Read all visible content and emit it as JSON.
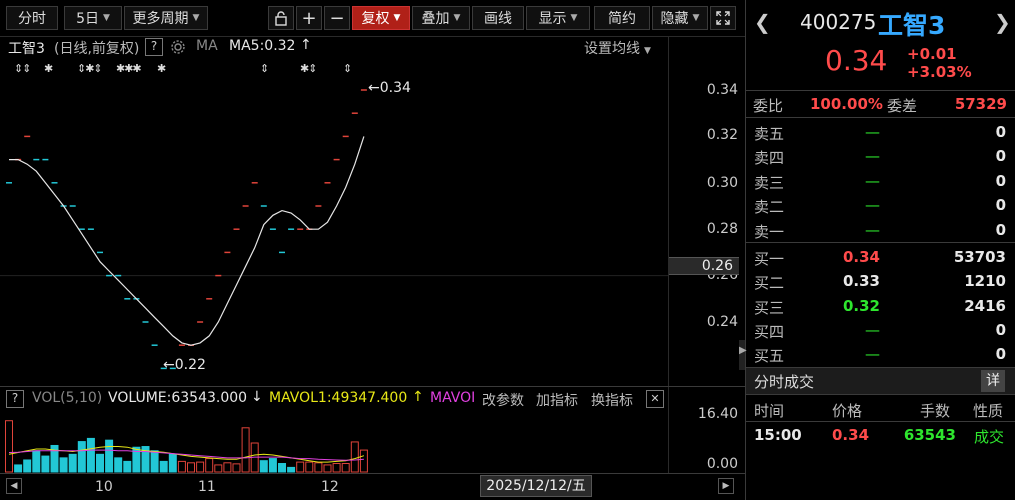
{
  "toolbar": {
    "tab_timeshare": "分时",
    "period_5day": "5日",
    "more_periods": "更多周期",
    "lock_icon": "lock-icon",
    "zoom_in": "+",
    "zoom_out": "−",
    "adjust": "复权",
    "overlay": "叠加",
    "draw": "画线",
    "display": "显示",
    "profile": "简约",
    "hide": "隐藏",
    "fullscreen_icon": "expand-icon"
  },
  "chart_header": {
    "name": "工智3",
    "mode": "(日线,前复权)",
    "help": "?",
    "ma_label": "MA",
    "ma5": "MA5:0.32",
    "ma5_arrow": "↑",
    "settings": "设置均线",
    "high_label": "0.34",
    "low_label": "0.22",
    "high_arrow": "←",
    "low_arrow": "←"
  },
  "volume_header": {
    "help": "?",
    "vol": "VOL(5,10)",
    "volume": "VOLUME:63543.000",
    "volume_arrow": "↓",
    "mavol1": "MAVOL1:49347.400",
    "mavol1_arrow": "↑",
    "mavol2": "MAVOI",
    "edit_params": "改参数",
    "add_indicator": "加指标",
    "switch_indicator": "换指标",
    "close": "✕"
  },
  "price_axis": [
    "0.34",
    "0.32",
    "0.30",
    "0.28",
    "0.26",
    "0.24"
  ],
  "current_price_tag": "0.26",
  "volume_axis": [
    "16.40",
    "0.00"
  ],
  "x_axis": [
    "10",
    "11",
    "12"
  ],
  "date_tag": "2025/12/12/五",
  "quote": {
    "code": "400275",
    "name": "工智3",
    "price": "0.34",
    "change": "+0.01",
    "change_pct": "+3.03%"
  },
  "order_ratio": {
    "ratio_label": "委比",
    "ratio_value": "100.00%",
    "diff_label": "委差",
    "diff_value": "57329"
  },
  "asks": [
    {
      "label": "卖五",
      "price": "—",
      "vol": "0"
    },
    {
      "label": "卖四",
      "price": "—",
      "vol": "0"
    },
    {
      "label": "卖三",
      "price": "—",
      "vol": "0"
    },
    {
      "label": "卖二",
      "price": "—",
      "vol": "0"
    },
    {
      "label": "卖一",
      "price": "—",
      "vol": "0"
    }
  ],
  "bids": [
    {
      "label": "买一",
      "price": "0.34",
      "vol": "53703"
    },
    {
      "label": "买二",
      "price": "0.33",
      "vol": "1210"
    },
    {
      "label": "买三",
      "price": "0.32",
      "vol": "2416"
    },
    {
      "label": "买四",
      "price": "—",
      "vol": "0"
    },
    {
      "label": "买五",
      "price": "—",
      "vol": "0"
    }
  ],
  "trades": {
    "title": "分时成交",
    "detail": "详",
    "headers": [
      "时间",
      "价格",
      "手数",
      "性质"
    ],
    "rows": [
      {
        "time": "15:00",
        "price": "0.34",
        "vol": "63543",
        "nature": "成交"
      }
    ]
  },
  "colors": {
    "up": "#ff4b4b",
    "down": "#2ee62e",
    "kline_up": "#e0443a",
    "kline_down": "#22c7d6",
    "ma": "#e6e6e6",
    "mavol1": "#e8e817",
    "mavol2": "#e040e0",
    "active_button": "#b02018"
  },
  "chart_data": [
    {
      "type": "candlestick",
      "title": "",
      "ylim": [
        0.22,
        0.34
      ],
      "x_axis_ticks": [
        "10",
        "11",
        "12"
      ],
      "y_axis_ticks": [
        "0.34",
        "0.32",
        "0.30",
        "0.28",
        "0.26",
        "0.24"
      ],
      "closes": [
        0.3,
        0.31,
        0.32,
        0.31,
        0.31,
        0.3,
        0.29,
        0.29,
        0.28,
        0.28,
        0.27,
        0.26,
        0.26,
        0.25,
        0.25,
        0.24,
        0.23,
        0.22,
        0.22,
        0.23,
        0.23,
        0.24,
        0.25,
        0.26,
        0.27,
        0.28,
        0.29,
        0.3,
        0.29,
        0.28,
        0.27,
        0.28,
        0.28,
        0.28,
        0.29,
        0.3,
        0.31,
        0.32,
        0.33,
        0.34
      ],
      "direction": [
        "d",
        "u",
        "u",
        "d",
        "d",
        "d",
        "d",
        "d",
        "d",
        "d",
        "d",
        "d",
        "d",
        "d",
        "d",
        "d",
        "d",
        "d",
        "d",
        "u",
        "u",
        "u",
        "u",
        "u",
        "u",
        "u",
        "u",
        "u",
        "d",
        "d",
        "d",
        "d",
        "u",
        "u",
        "u",
        "u",
        "u",
        "u",
        "u",
        "u"
      ],
      "ma5": [
        0.31,
        0.31,
        0.308,
        0.305,
        0.3,
        0.295,
        0.29,
        0.284,
        0.278,
        0.272,
        0.266,
        0.262,
        0.258,
        0.254,
        0.25,
        0.246,
        0.242,
        0.238,
        0.234,
        0.231,
        0.23,
        0.231,
        0.234,
        0.24,
        0.248,
        0.256,
        0.264,
        0.272,
        0.282,
        0.286,
        0.288,
        0.287,
        0.284,
        0.28,
        0.28,
        0.283,
        0.29,
        0.298,
        0.308,
        0.32
      ],
      "high_marker": 0.34,
      "low_marker": 0.22,
      "series": [
        {
          "name": "MA5",
          "values_key": "ma5"
        }
      ]
    },
    {
      "type": "bar",
      "title": "",
      "ylim": [
        0,
        16.4
      ],
      "y_axis_ticks": [
        "16.40",
        "0.00"
      ],
      "values": [
        14.5,
        2.0,
        3.4,
        6.0,
        4.5,
        7.5,
        4.0,
        5.0,
        8.6,
        9.5,
        5.0,
        9.0,
        4.0,
        3.0,
        7.0,
        7.2,
        6.0,
        3.0,
        5.0,
        3.0,
        2.6,
        2.8,
        3.8,
        2.0,
        2.6,
        2.3,
        12.5,
        8.2,
        3.2,
        3.8,
        2.4,
        1.3,
        2.8,
        2.8,
        2.6,
        2.0,
        2.4,
        2.4,
        8.5,
        6.2
      ],
      "direction": [
        "u",
        "d",
        "d",
        "d",
        "d",
        "d",
        "d",
        "d",
        "d",
        "d",
        "d",
        "d",
        "d",
        "d",
        "d",
        "d",
        "d",
        "d",
        "d",
        "u",
        "u",
        "u",
        "u",
        "u",
        "u",
        "u",
        "u",
        "u",
        "d",
        "d",
        "d",
        "d",
        "u",
        "u",
        "u",
        "u",
        "u",
        "u",
        "u",
        "u"
      ],
      "series": [
        {
          "name": "MAVOL1",
          "values": [
            5.0,
            5.5,
            6.0,
            6.5,
            6.5,
            6.2,
            6.0,
            5.8,
            6.2,
            6.6,
            7.0,
            7.2,
            7.2,
            7.0,
            6.4,
            6.0,
            5.8,
            5.6,
            5.2,
            4.8,
            4.4,
            4.2,
            4.0,
            3.8,
            3.6,
            3.6,
            4.2,
            4.8,
            5.0,
            4.8,
            4.4,
            4.0,
            3.6,
            3.2,
            2.8,
            2.8,
            3.0,
            3.2,
            3.8,
            4.6
          ]
        },
        {
          "name": "MAVOI",
          "values": [
            5.5,
            5.6,
            5.8,
            6.0,
            6.0,
            6.0,
            6.0,
            6.0,
            6.0,
            6.2,
            6.2,
            6.2,
            6.0,
            6.0,
            5.8,
            5.8,
            5.6,
            5.4,
            5.2,
            5.0,
            4.8,
            4.6,
            4.4,
            4.2,
            4.0,
            4.0,
            4.0,
            4.2,
            4.2,
            4.2,
            4.2,
            4.0,
            3.8,
            3.8,
            3.6,
            3.5,
            3.4,
            3.3,
            3.4,
            3.6
          ]
        }
      ]
    }
  ]
}
